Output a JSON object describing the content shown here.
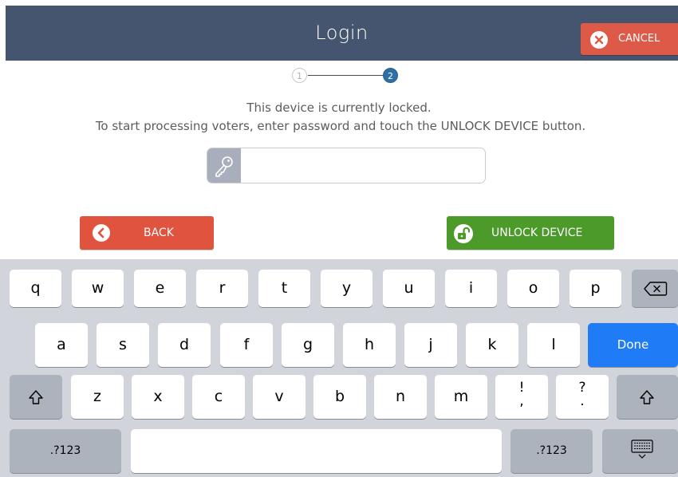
{
  "header": {
    "title": "Login",
    "cancel_label": "CANCEL"
  },
  "stepper": {
    "steps": [
      "1",
      "2"
    ],
    "current": 2
  },
  "message": {
    "line1": "This device is currently locked.",
    "line2": "To start processing voters, enter password and touch the UNLOCK DEVICE button."
  },
  "password": {
    "value": "",
    "icon": "key-icon"
  },
  "buttons": {
    "back_label": "BACK",
    "unlock_label": "UNLOCK DEVICE"
  },
  "keyboard": {
    "row1": [
      "q",
      "w",
      "e",
      "r",
      "t",
      "y",
      "u",
      "i",
      "o",
      "p"
    ],
    "row2": [
      "a",
      "s",
      "d",
      "f",
      "g",
      "h",
      "j",
      "k",
      "l"
    ],
    "done_label": "Done",
    "row3": [
      "z",
      "x",
      "c",
      "v",
      "b",
      "n",
      "m"
    ],
    "punct1_top": "!",
    "punct1_bottom": ",",
    "punct2_top": "?",
    "punct2_bottom": ".",
    "numbers_label": ".?123"
  },
  "colors": {
    "header": "#46556f",
    "cancel": "#de5a48",
    "back": "#e0533f",
    "unlock": "#4c9a2a",
    "done": "#1f7cf6",
    "step_active": "#2f6fa5"
  }
}
